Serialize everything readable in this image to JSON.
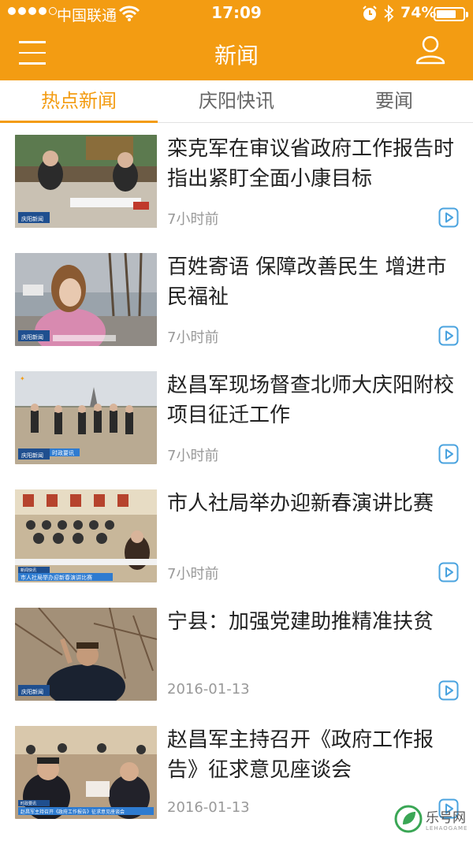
{
  "status_bar": {
    "carrier": "中国联通",
    "time": "17:09",
    "battery_percent": "74%",
    "battery_level": 0.74,
    "icons": [
      "signal-dots",
      "wifi-icon",
      "alarm-icon",
      "bluetooth-icon",
      "battery-icon"
    ]
  },
  "nav": {
    "title": "新闻",
    "left_icon": "menu-icon",
    "right_icon": "user-icon"
  },
  "tabs": [
    {
      "label": "热点新闻",
      "active": true
    },
    {
      "label": "庆阳快讯",
      "active": false
    },
    {
      "label": "要闻",
      "active": false
    }
  ],
  "news": [
    {
      "headline": "栾克军在审议省政府工作报告时指出紧盯全面小康目标",
      "time": "7小时前",
      "icon": "play-video-icon",
      "thumb_captions": [
        "庆阳新闻"
      ]
    },
    {
      "headline": "百姓寄语 保障改善民生 增进市民福祉",
      "time": "7小时前",
      "icon": "play-video-icon",
      "thumb_captions": [
        "庆阳新闻"
      ]
    },
    {
      "headline": "赵昌军现场督查北师大庆阳附校项目征迁工作",
      "time": "7小时前",
      "icon": "play-video-icon",
      "thumb_captions": [
        "庆阳新闻",
        "时政要讯"
      ]
    },
    {
      "headline": "市人社局举办迎新春演讲比赛",
      "time": "7小时前",
      "icon": "play-video-icon",
      "thumb_captions": [
        "新闻快讯",
        "市人社局举办迎新春演讲比赛"
      ]
    },
    {
      "headline": "宁县：加强党建助推精准扶贫",
      "time": "2016-01-13",
      "icon": "play-video-icon",
      "thumb_captions": [
        "庆阳新闻"
      ]
    },
    {
      "headline": "赵昌军主持召开《政府工作报告》征求意见座谈会",
      "time": "2016-01-13",
      "icon": "play-video-icon",
      "thumb_captions": [
        "时政要讯",
        "赵昌军主持召开《政府工作报告》征求意见座谈会"
      ]
    }
  ],
  "watermark": {
    "text": "乐号网",
    "sub": "LEHAOGAME"
  },
  "colors": {
    "accent": "#f39c12",
    "text": "#222222",
    "muted": "#999999",
    "play": "#4aa3df"
  }
}
